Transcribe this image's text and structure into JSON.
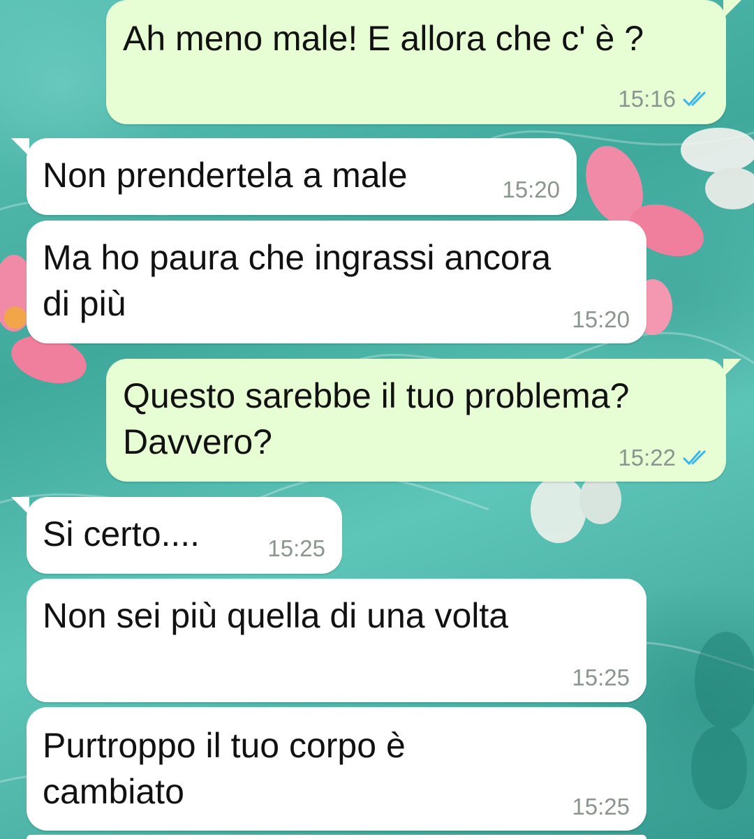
{
  "messages": [
    {
      "direction": "out",
      "text": "Ah meno male! E allora che c' è ?",
      "time": "15:16",
      "status": "read"
    },
    {
      "direction": "in",
      "text": "Non prendertela a male",
      "time": "15:20"
    },
    {
      "direction": "in",
      "text": "Ma ho paura che ingrassi ancora\ndi più",
      "time": "15:20"
    },
    {
      "direction": "out",
      "text": "Questo sarebbe il tuo problema?\nDavvero?",
      "time": "15:22",
      "status": "read"
    },
    {
      "direction": "in",
      "text": "Si certo....",
      "time": "15:25"
    },
    {
      "direction": "in",
      "text": "Non sei più quella di una volta",
      "time": "15:25"
    },
    {
      "direction": "in",
      "text": "Purtroppo il tuo corpo è\ncambiato",
      "time": "15:25"
    }
  ],
  "colors": {
    "outgoing_bubble": "#e7fdd3",
    "incoming_bubble": "#ffffff",
    "read_ticks": "#34b7f1",
    "timestamp": "#8a958e",
    "wallpaper": "#48b5a8"
  },
  "icons": {
    "read_status": "double-check-icon"
  }
}
